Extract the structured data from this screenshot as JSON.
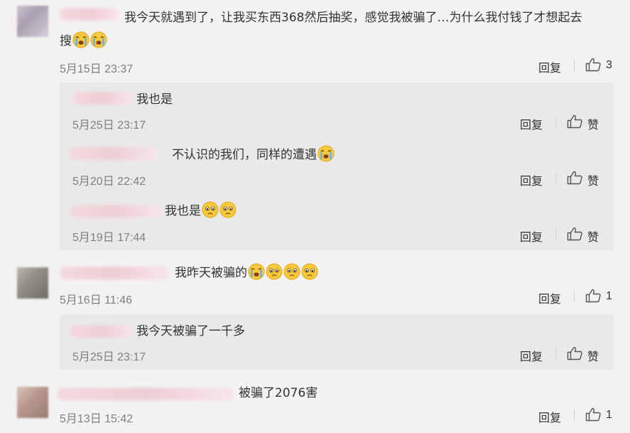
{
  "comments": [
    {
      "text": "我今天就遇到了，让我买东西368然后抽奖，感觉我被骗了…为什么我付钱了才想起去",
      "text2": "搜",
      "time": "5月15日 23:37",
      "reply": "回复",
      "likes": "3",
      "emoji_text2": [
        "crying-emoji",
        "crying-emoji"
      ],
      "sub": [
        {
          "text": "我也是",
          "time": "5月25日 23:17",
          "reply": "回复",
          "like": "赞"
        },
        {
          "text": "不认识的我们，同样的遭遇",
          "time": "5月20日 22:42",
          "reply": "回复",
          "like": "赞",
          "emoji": [
            "crying-emoji"
          ]
        },
        {
          "text": "我也是",
          "time": "5月19日 17:44",
          "reply": "回复",
          "like": "赞",
          "emoji": [
            "sad-emoji",
            "sad-emoji"
          ]
        }
      ]
    },
    {
      "text": "我昨天被骗的",
      "time": "5月16日 11:46",
      "reply": "回复",
      "likes": "1",
      "emoji": [
        "crying-emoji",
        "sad-emoji",
        "sad-emoji",
        "sad-emoji"
      ],
      "sub": [
        {
          "text": "我今天被骗了一千多",
          "time": "5月25日 23:17",
          "reply": "回复",
          "like": "赞"
        }
      ]
    },
    {
      "text": "被骗了2076害",
      "time": "5月13日 15:42",
      "reply": "回复",
      "likes": "1"
    }
  ]
}
